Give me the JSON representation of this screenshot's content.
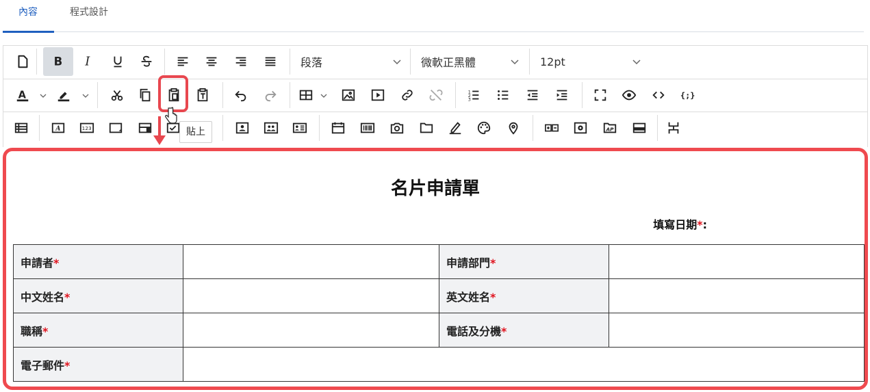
{
  "tabs": {
    "content_label": "內容",
    "code_label": "程式設計"
  },
  "toolbar": {
    "paragraph_format": "段落",
    "font_family": "微軟正黑體",
    "font_size": "12pt",
    "tooltip_paste": "貼上",
    "highlight_color": "#e8474f"
  },
  "document": {
    "title": "名片申請單",
    "fill_date_label": "填寫日期",
    "fill_date_suffix": ":",
    "required_mark": "*",
    "fields": {
      "applicant": "申請者",
      "department": "申請部門",
      "chinese_name": "中文姓名",
      "english_name": "英文姓名",
      "job_title": "職稱",
      "phone_ext": "電話及分機",
      "email": "電子郵件"
    }
  }
}
